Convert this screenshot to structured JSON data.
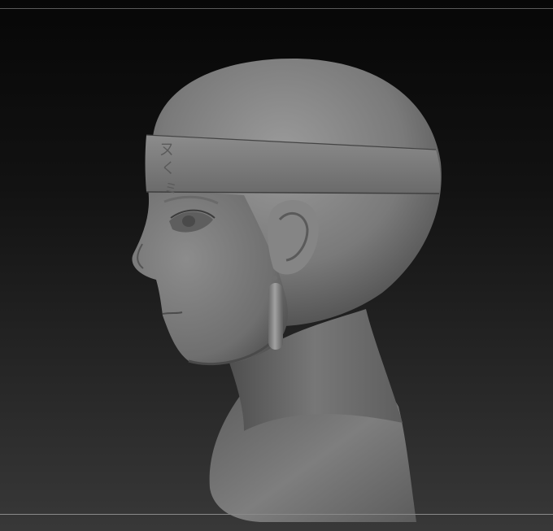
{
  "viewport": {
    "background_top": "#070707",
    "background_bottom": "#383838",
    "model_color": "#7b7b7b",
    "frame_line_color": "#8a8a8a"
  },
  "model": {
    "subject": "sculpted-head-bust",
    "headband_glyphs": [
      "ㄡ",
      "く",
      "ミ"
    ]
  }
}
